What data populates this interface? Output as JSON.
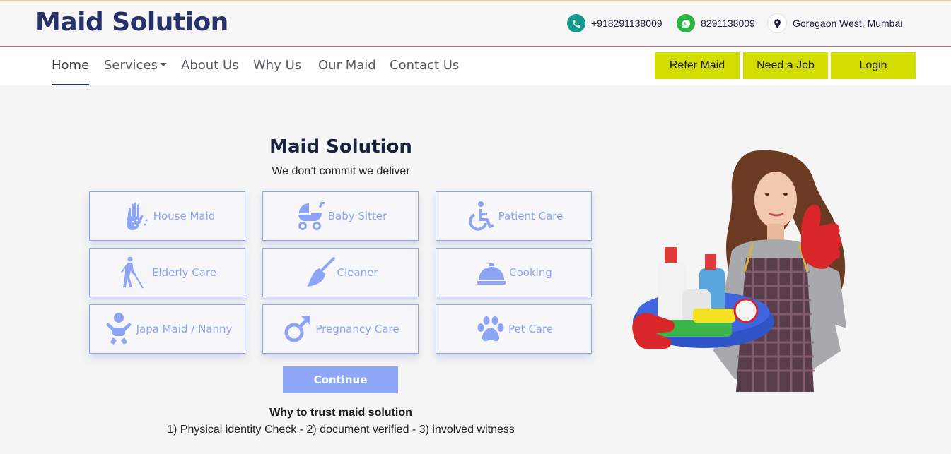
{
  "header": {
    "brand": "Maid Solution",
    "phone": "+918291138009",
    "whatsapp": "8291138009",
    "location": "Goregaon West, Mumbai"
  },
  "nav": {
    "items": [
      "Home",
      "Services",
      "About Us",
      "Why Us",
      "Our Maid",
      "Contact Us"
    ],
    "active": "Home"
  },
  "actions": {
    "refer": "Refer Maid",
    "job": "Need a Job",
    "login": "Login"
  },
  "hero": {
    "title": "Maid Solution",
    "subtitle": "We don’t commit we deliver"
  },
  "services": [
    {
      "label": "House Maid",
      "icon": "hand-sparkles-icon"
    },
    {
      "label": "Baby Sitter",
      "icon": "baby-carriage-icon"
    },
    {
      "label": "Patient Care",
      "icon": "wheelchair-icon"
    },
    {
      "label": "Elderly Care",
      "icon": "blind-person-icon"
    },
    {
      "label": "Cleaner",
      "icon": "broom-icon"
    },
    {
      "label": "Cooking",
      "icon": "concierge-bell-icon"
    },
    {
      "label": "Japa Maid / Nanny",
      "icon": "baby-icon"
    },
    {
      "label": "Pregnancy Care",
      "icon": "mars-icon"
    },
    {
      "label": "Pet Care",
      "icon": "paw-icon"
    }
  ],
  "continue_label": "Continue",
  "trust": {
    "title": "Why to trust maid solution",
    "text": "1) Physical identity Check - 2) document verified - 3) involved witness"
  },
  "colors": {
    "brand": "#27326a",
    "accent_button": "#d4dd00",
    "service": "#8ea5f7",
    "phone_icon": "#139a8d",
    "whatsapp_icon": "#2ab540"
  }
}
